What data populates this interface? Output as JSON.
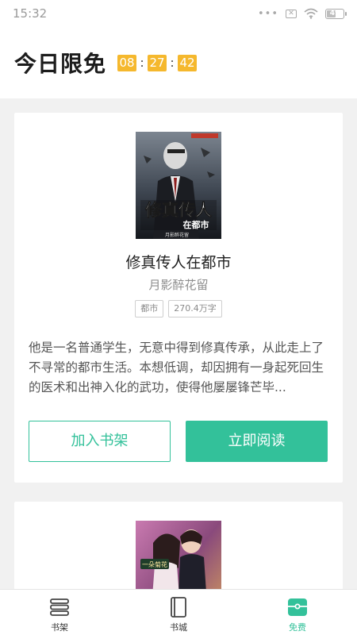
{
  "status_bar": {
    "time": "15:32",
    "signal_dots": "•••",
    "battery_level": "49",
    "battery_fraction": 0.49
  },
  "header": {
    "title": "今日限免",
    "countdown": {
      "hours": "08",
      "minutes": "27",
      "seconds": "42",
      "separator": ":"
    }
  },
  "books": [
    {
      "cover_text_main": "修真传人",
      "cover_text_sub": "在都市",
      "cover_author": "月影醉花留",
      "title": "修真传人在都市",
      "author": "月影醉花留",
      "tags": [
        "都市",
        "270.4万字"
      ],
      "description": "他是一名普通学生，无意中得到修真传承，从此走上了不寻常的都市生活。本想低调，却因拥有一身起死回生的医术和出神入化的武功，使得他屡屡锋芒毕..."
    },
    {
      "cover_text_main": "一朵菊花"
    }
  ],
  "buttons": {
    "add_to_shelf": "加入书架",
    "read_now": "立即阅读"
  },
  "tabs": [
    {
      "label": "书架",
      "icon": "bookshelf-icon"
    },
    {
      "label": "书城",
      "icon": "book-icon"
    },
    {
      "label": "免费",
      "icon": "free-ticket-icon",
      "active": true
    }
  ],
  "colors": {
    "accent": "#33c19a",
    "countdown": "#f5b82d"
  }
}
